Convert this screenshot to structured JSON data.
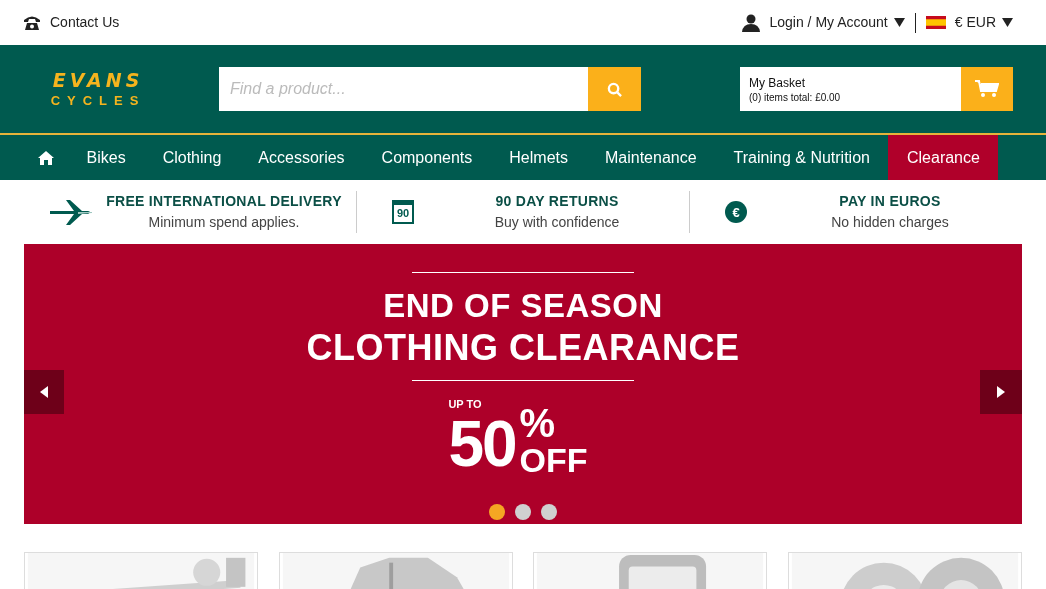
{
  "top_bar": {
    "contact": "Contact Us",
    "account": "Login / My Account",
    "currency": "€ EUR"
  },
  "header": {
    "logo": {
      "line1": "EVANS",
      "line2": "CYCLES"
    },
    "search": {
      "placeholder": "Find a product..."
    },
    "basket": {
      "title": "My Basket",
      "summary": "(0) items total: £0.00"
    }
  },
  "nav": {
    "items": [
      {
        "label": "Bikes",
        "selected": false
      },
      {
        "label": "Clothing",
        "selected": false
      },
      {
        "label": "Accessories",
        "selected": false
      },
      {
        "label": "Components",
        "selected": false
      },
      {
        "label": "Helmets",
        "selected": false
      },
      {
        "label": "Maintenance",
        "selected": false
      },
      {
        "label": "Training & Nutrition",
        "selected": false
      },
      {
        "label": "Clearance",
        "selected": true
      }
    ]
  },
  "features": [
    {
      "kind": "plane",
      "title": "FREE INTERNATIONAL DELIVERY",
      "subtitle": "Minimum spend applies."
    },
    {
      "kind": "calendar",
      "icon_text": "90",
      "title": "90 DAY RETURNS",
      "subtitle": "Buy with confidence"
    },
    {
      "kind": "euro",
      "icon_text": "€",
      "title": "PAY IN EUROS",
      "subtitle": "No hidden charges"
    }
  ],
  "banner": {
    "line1": "END OF SEASON",
    "line2": "CLOTHING CLEARANCE",
    "upto": "UP TO",
    "amount": "50",
    "percent": "%",
    "off": "OFF",
    "dots": [
      {
        "selected": true
      },
      {
        "selected": false
      },
      {
        "selected": false
      }
    ]
  }
}
